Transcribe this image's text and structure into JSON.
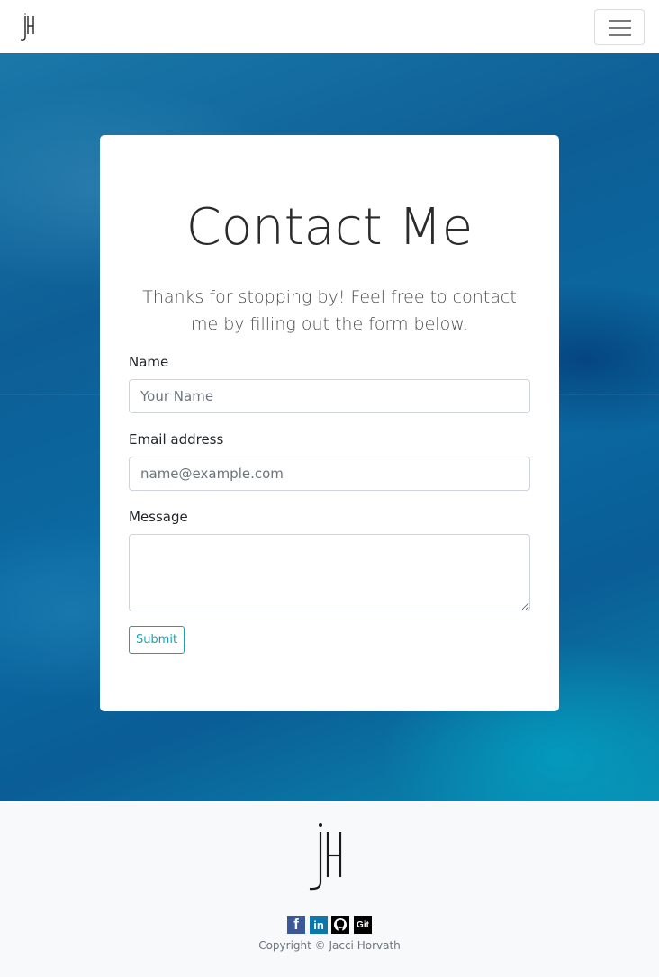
{
  "navbar": {
    "logo_icon": "jh-monogram-logo",
    "toggler_icon": "hamburger-menu-icon"
  },
  "hero": {
    "background": "ocean-water-texture",
    "colors": {
      "deep": "#0d5e96",
      "light": "#0a8ab0"
    }
  },
  "contact": {
    "title": "Contact Me",
    "subtitle": "Thanks for stopping by! Feel free to contact me by filling out the form below.",
    "name_label": "Name",
    "name_placeholder": "Your Name",
    "email_label": "Email address",
    "email_placeholder": "name@example.com",
    "message_label": "Message",
    "message_value": "",
    "submit_label": "Submit",
    "accent_color": "#17a2b8"
  },
  "footer": {
    "logo_icon": "jh-monogram-logo",
    "social": [
      {
        "icon": "facebook-icon",
        "glyph": "f",
        "color": "#3b5998"
      },
      {
        "icon": "linkedin-icon",
        "glyph": "in",
        "color": "#0e76a8"
      },
      {
        "icon": "github-icon",
        "glyph": "",
        "color": "#000000"
      },
      {
        "icon": "git-icon",
        "glyph": "Git",
        "color": "#000000"
      }
    ],
    "copyright": "Copyright © Jacci Horvath"
  }
}
